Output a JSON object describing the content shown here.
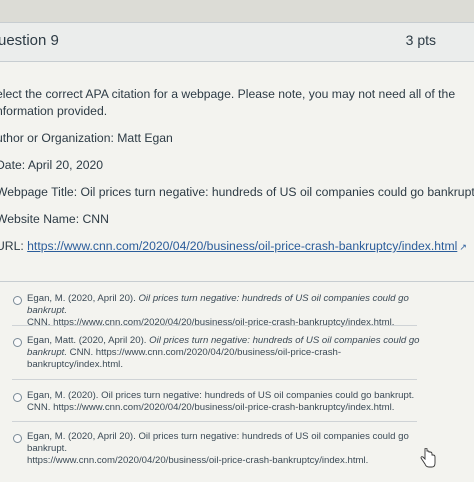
{
  "question": {
    "title": "uestion 9",
    "points": "3 pts"
  },
  "prompt": {
    "line1": "elect the correct APA citation for a webpage. Please note, you may not need all of the",
    "line2": "nformation provided.",
    "author": "uthor or Organization: Matt Egan",
    "date": "Date: April 20, 2020",
    "title": "Webpage Title: Oil prices turn negative: hundreds of US oil companies could go bankrupt.",
    "site": "Website Name: CNN",
    "url_label": "URL: ",
    "url": "https://www.cnn.com/2020/04/20/business/oil-price-crash-bankruptcy/index.html"
  },
  "options": [
    {
      "a": "Egan, M. (2020, April 20). ",
      "b": "Oil prices turn negative: hundreds of US oil companies could go bankrupt.",
      "c": "CNN. https://www.cnn.com/2020/04/20/business/oil-price-crash-bankruptcy/index.html."
    },
    {
      "a": "Egan, Matt. (2020, April 20). ",
      "b": "Oil prices turn negative: hundreds of US oil companies could go",
      "c1": "bankrupt. ",
      "c2": "CNN. https://www.cnn.com/2020/04/20/business/oil-price-crash-",
      "d": "bankruptcy/index.html."
    },
    {
      "a": "Egan, M. (2020). ",
      "b": "Oil prices turn negative: hundreds of US oil companies could go bankrupt.",
      "c": "CNN. https://www.cnn.com/2020/04/20/business/oil-price-crash-bankruptcy/index.html."
    },
    {
      "a": "Egan, M. (2020, April 20). ",
      "b": "Oil prices turn negative: hundreds of US oil companies could go bankrupt.",
      "c": "https://www.cnn.com/2020/04/20/business/oil-price-crash-bankruptcy/index.html."
    }
  ]
}
